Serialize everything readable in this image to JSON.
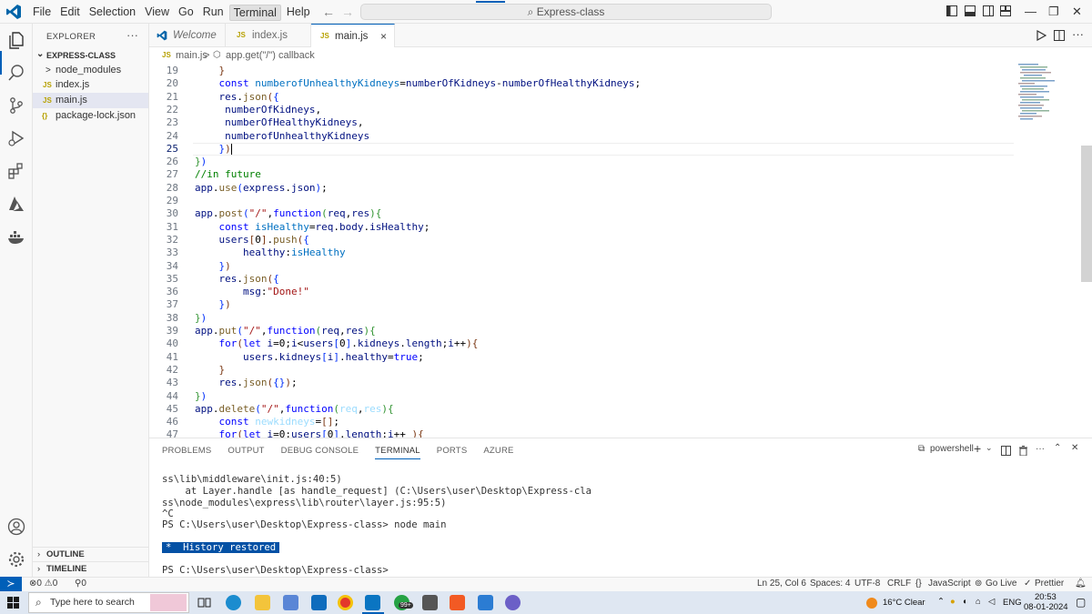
{
  "titlebar": {
    "menu": [
      "File",
      "Edit",
      "Selection",
      "View",
      "Go",
      "Run",
      "Terminal",
      "Help"
    ],
    "active_menu_index": 6,
    "command_center": "Express-class"
  },
  "sidebar": {
    "header": "EXPLORER",
    "folder": "EXPRESS-CLASS",
    "items": [
      {
        "icon": ">",
        "label": "node_modules"
      },
      {
        "icon": "JS",
        "label": "index.js"
      },
      {
        "icon": "JS",
        "label": "main.js",
        "selected": true
      },
      {
        "icon": "{}",
        "label": "package-lock.json"
      }
    ],
    "outline": "OUTLINE",
    "timeline": "TIMELINE"
  },
  "tabs": [
    {
      "icon": "vscode-icon",
      "label": "Welcome",
      "italic": true
    },
    {
      "icon": "JS",
      "label": "index.js"
    },
    {
      "icon": "JS",
      "label": "main.js",
      "active": true,
      "close": "×"
    }
  ],
  "breadcrumb": {
    "file_icon": "JS",
    "file": "main.js",
    "sep": ">",
    "symbol": "app.get(\"/\") callback"
  },
  "editor": {
    "current_line": 25,
    "lines": [
      {
        "n": "19",
        "html": "    <span class='br3'>}</span>"
      },
      {
        "n": "20",
        "html": "    <span class='kw'>const</span> <span class='vr'>numberofUnhealthyKidneys</span>=<span class='id'>numberOfKidneys</span>-<span class='id'>numberOfHealthyKidneys</span>;"
      },
      {
        "n": "21",
        "html": "    <span class='id'>res</span>.<span class='fn'>json</span><span class='br3'>(</span><span class='br1'>{</span>"
      },
      {
        "n": "22",
        "html": "     <span class='id'>numberOfKidneys</span>,"
      },
      {
        "n": "23",
        "html": "     <span class='id'>numberOfHealthyKidneys</span>,"
      },
      {
        "n": "24",
        "html": "     <span class='id'>numberofUnhealthyKidneys</span>"
      },
      {
        "n": "25",
        "html": "    <span class='br1'>}</span><span class='br3'>)</span><span class='caret'></span>"
      },
      {
        "n": "26",
        "html": "<span class='br2'>}</span><span class='br1'>)</span>"
      },
      {
        "n": "27",
        "html": "<span class='cm'>//in future</span>"
      },
      {
        "n": "28",
        "html": "<span class='id'>app</span>.<span class='fn'>use</span><span class='br1'>(</span><span class='id'>express</span>.<span class='id'>json</span><span class='br1'>)</span>;"
      },
      {
        "n": "29",
        "html": ""
      },
      {
        "n": "30",
        "html": "<span class='id'>app</span>.<span class='fn'>post</span><span class='br1'>(</span><span class='str'>\"/\"</span>,<span class='kw'>function</span><span class='br2'>(</span><span class='id'>req</span>,<span class='id'>res</span><span class='br2'>)</span><span class='br2'>{</span>"
      },
      {
        "n": "31",
        "html": "    <span class='kw'>const</span> <span class='vr'>isHealthy</span>=<span class='id'>req</span>.<span class='id'>body</span>.<span class='id'>isHealthy</span>;"
      },
      {
        "n": "32",
        "html": "    <span class='id'>users</span><span class='br3'>[</span>0<span class='br3'>]</span>.<span class='fn'>push</span><span class='br3'>(</span><span class='br1'>{</span>"
      },
      {
        "n": "33",
        "html": "        <span class='id'>healthy</span>:<span class='vr'>isHealthy</span>"
      },
      {
        "n": "34",
        "html": "    <span class='br1'>}</span><span class='br3'>)</span>"
      },
      {
        "n": "35",
        "html": "    <span class='id'>res</span>.<span class='fn'>json</span><span class='br3'>(</span><span class='br1'>{</span>"
      },
      {
        "n": "36",
        "html": "        <span class='id'>msg</span>:<span class='str'>\"Done!\"</span>"
      },
      {
        "n": "37",
        "html": "    <span class='br1'>}</span><span class='br3'>)</span>"
      },
      {
        "n": "38",
        "html": "<span class='br2'>}</span><span class='br1'>)</span>"
      },
      {
        "n": "39",
        "html": "<span class='id'>app</span>.<span class='fn'>put</span><span class='br1'>(</span><span class='str'>\"/\"</span>,<span class='kw'>function</span><span class='br2'>(</span><span class='id'>req</span>,<span class='id'>res</span><span class='br2'>)</span><span class='br2'>{</span>"
      },
      {
        "n": "40",
        "html": "    <span class='kw'>for</span><span class='br3'>(</span><span class='kw'>let</span> <span class='id'>i</span>=0;<span class='id'>i</span>&lt;<span class='id'>users</span><span class='br1'>[</span>0<span class='br1'>]</span>.<span class='id'>kidneys</span>.<span class='id'>length</span>;<span class='id'>i</span>++<span class='br3'>)</span><span class='br3'>{</span>"
      },
      {
        "n": "41",
        "html": "        <span class='id'>users</span>.<span class='id'>kidneys</span><span class='br1'>[</span><span class='id'>i</span><span class='br1'>]</span>.<span class='id'>healthy</span>=<span class='kw'>true</span>;"
      },
      {
        "n": "42",
        "html": "    <span class='br3'>}</span>"
      },
      {
        "n": "43",
        "html": "    <span class='id'>res</span>.<span class='fn'>json</span><span class='br3'>(</span><span class='br1'>{}</span><span class='br3'>)</span>;"
      },
      {
        "n": "44",
        "html": "<span class='br2'>}</span><span class='br1'>)</span>"
      },
      {
        "n": "45",
        "html": "<span class='id'>app</span>.<span class='fn'>delete</span><span class='br1'>(</span><span class='str'>\"/\"</span>,<span class='kw'>function</span><span class='br2'>(</span><span class='dim'>req</span>,<span class='dim'>res</span><span class='br2'>)</span><span class='br2'>{</span>"
      },
      {
        "n": "46",
        "html": "    <span class='kw'>const</span> <span class='dim'>newkidneys</span>=<span class='br3'>[]</span>;"
      },
      {
        "n": "47",
        "html": "    <span class='kw'>for</span><span class='br3'>(</span><span class='kw'>let</span> <span class='id'>i</span>=0;<span class='id'>users</span><span class='br1'>[</span>0<span class='br1'>]</span>.<span class='id'>length</span>;<span class='id'>i</span>++ <span class='br3'>)</span><span class='br3'>{</span>"
      }
    ]
  },
  "panel": {
    "tabs": [
      "PROBLEMS",
      "OUTPUT",
      "DEBUG CONSOLE",
      "TERMINAL",
      "PORTS",
      "AZURE"
    ],
    "active_tab_index": 3,
    "shell": "powershell",
    "terminal_lines": [
      "ss\\lib\\middleware\\init.js:40:5)",
      "    at Layer.handle [as handle_request] (C:\\Users\\user\\Desktop\\Express-cla",
      "ss\\node_modules\\express\\lib\\router\\layer.js:95:5)",
      "^C",
      "PS C:\\Users\\user\\Desktop\\Express-class> node main"
    ],
    "history_restored": "*  History restored",
    "prompt": "PS C:\\Users\\user\\Desktop\\Express-class>"
  },
  "statusbar": {
    "errors": "0",
    "warnings": "0",
    "ports": "0",
    "position": "Ln 25, Col 6",
    "spaces": "Spaces: 4",
    "encoding": "UTF-8",
    "eol": "CRLF",
    "language": "JavaScript",
    "golive": "Go Live",
    "prettier": "Prettier"
  },
  "taskbar": {
    "search_placeholder": "Type here to search",
    "whatsapp_badge": "99+",
    "weather": "16°C  Clear",
    "lang": "ENG",
    "time": "20:53",
    "date": "08-01-2024"
  },
  "colors": {
    "accent": "#005fb8",
    "terminal_highlight": "#0451a5"
  }
}
